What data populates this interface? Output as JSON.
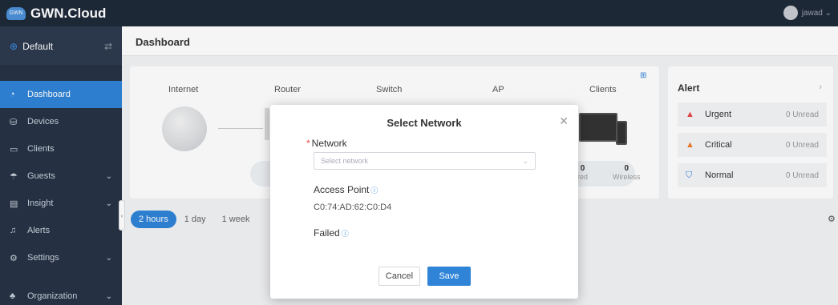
{
  "app": {
    "brand": "GWN.Cloud",
    "logo_text": "GWN",
    "user": "jawad"
  },
  "network_selector": {
    "label": "Default"
  },
  "sidebar": {
    "items": [
      {
        "label": "Dashboard",
        "icon": "dashboard-icon",
        "active": true
      },
      {
        "label": "Devices",
        "icon": "devices-icon"
      },
      {
        "label": "Clients",
        "icon": "clients-icon"
      },
      {
        "label": "Guests",
        "icon": "guests-icon",
        "expandable": true
      },
      {
        "label": "Insight",
        "icon": "insight-icon",
        "expandable": true
      },
      {
        "label": "Alerts",
        "icon": "bell-icon"
      },
      {
        "label": "Settings",
        "icon": "gear-icon",
        "expandable": true
      },
      {
        "label": "Organization",
        "icon": "organization-icon",
        "expandable": true
      }
    ]
  },
  "page": {
    "title": "Dashboard"
  },
  "topology": {
    "labels": [
      "Internet",
      "Router",
      "Switch",
      "AP",
      "Clients"
    ],
    "wired": {
      "value": "0",
      "label": "red"
    },
    "wireless": {
      "value": "0",
      "label": "Wireless"
    }
  },
  "time_tabs": [
    "2 hours",
    "1 day",
    "1 week"
  ],
  "alert_panel": {
    "title": "Alert",
    "rows": [
      {
        "label": "Urgent",
        "count": "0 Unread",
        "color": "#e54545"
      },
      {
        "label": "Critical",
        "count": "0 Unread",
        "color": "#f07a2a"
      },
      {
        "label": "Normal",
        "count": "0 Unread",
        "color": "#2f84d8"
      }
    ]
  },
  "modal": {
    "title": "Select Network",
    "network_label": "Network",
    "network_required": "*",
    "network_placeholder": "Select network",
    "access_point_label": "Access Point",
    "access_point_mac": "C0:74:AD:62:C0:D4",
    "failed_label": "Failed",
    "cancel_label": "Cancel",
    "save_label": "Save"
  },
  "colors": {
    "accent": "#2f84d8",
    "sidebar": "#273446",
    "topbar": "#1f2a3a"
  }
}
